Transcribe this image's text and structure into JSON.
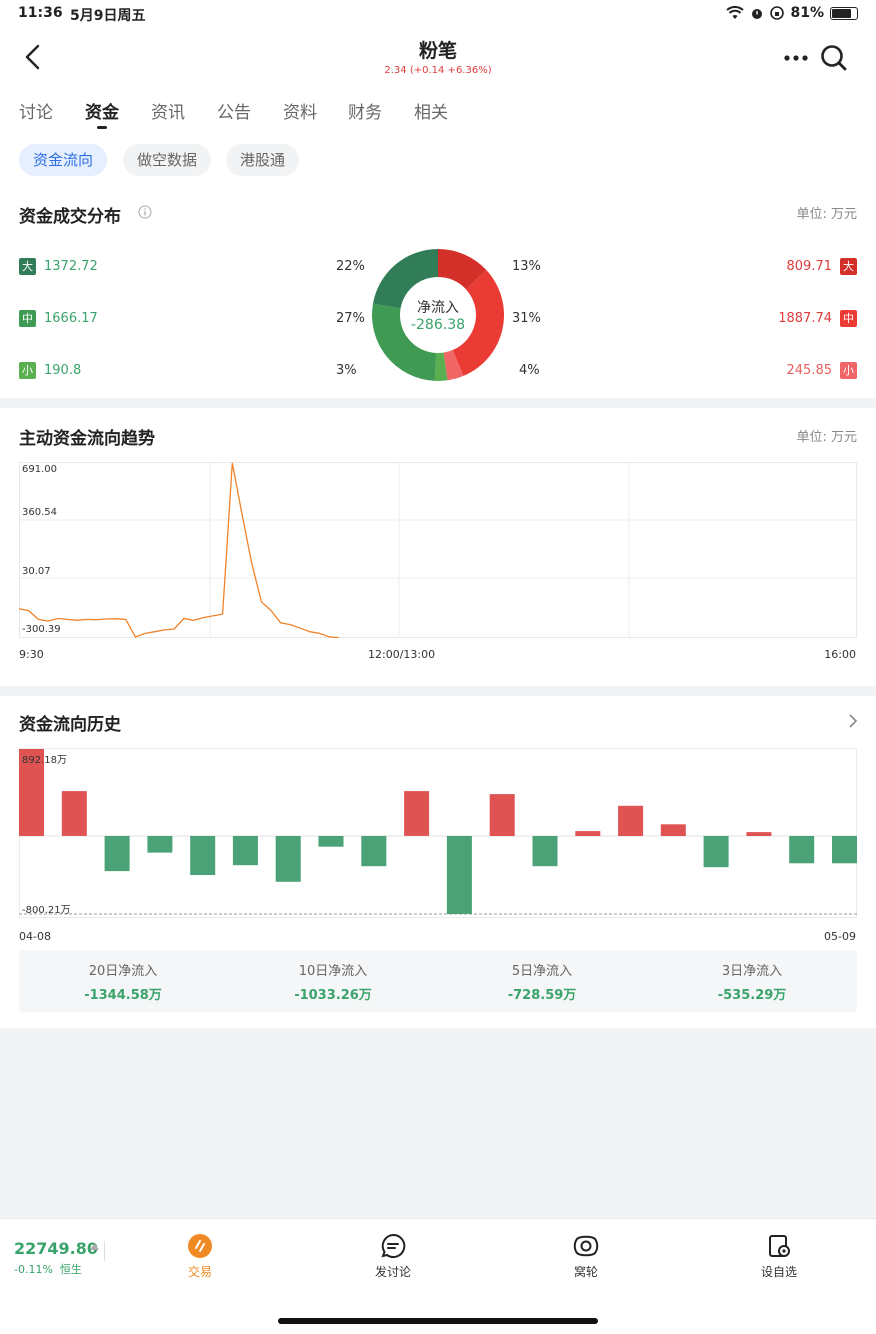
{
  "status": {
    "time": "11:36",
    "date": "5月9日周五",
    "battery": "81%"
  },
  "header": {
    "title": "粉笔",
    "subtitle": "2.34 (+0.14 +6.36%)"
  },
  "tabs": [
    "讨论",
    "资金",
    "资讯",
    "公告",
    "资料",
    "财务",
    "相关"
  ],
  "subtabs": [
    "资金流向",
    "做空数据",
    "港股通"
  ],
  "distribution": {
    "title": "资金成交分布",
    "unit": "单位: 万元",
    "center_label": "净流入",
    "center_value": "-286.38",
    "outflow": [
      {
        "tag": "大",
        "value": "1372.72",
        "pct": "22%"
      },
      {
        "tag": "中",
        "value": "1666.17",
        "pct": "27%"
      },
      {
        "tag": "小",
        "value": "190.8",
        "pct": "3%"
      }
    ],
    "inflow": [
      {
        "tag": "大",
        "value": "809.71",
        "pct": "13%"
      },
      {
        "tag": "中",
        "value": "1887.74",
        "pct": "31%"
      },
      {
        "tag": "小",
        "value": "245.85",
        "pct": "4%"
      }
    ],
    "colors": {
      "out_big": "#317d57",
      "out_mid": "#3f9a54",
      "out_small": "#5ab050",
      "in_big": "#d4302a",
      "in_mid": "#ea3b35",
      "in_small": "#f06565"
    }
  },
  "trend": {
    "title": "主动资金流向趋势",
    "unit": "单位: 万元",
    "y_labels": [
      "691.00",
      "360.54",
      "30.07",
      "-300.39"
    ],
    "x_labels": [
      "9:30",
      "12:00/13:00",
      "16:00"
    ]
  },
  "history": {
    "title": "资金流向历史",
    "max_label": "892.18万",
    "min_label": "-800.21万",
    "x_start": "04-08",
    "x_end": "05-09",
    "summary": [
      {
        "label": "20日净流入",
        "value": "-1344.58万"
      },
      {
        "label": "10日净流入",
        "value": "-1033.26万"
      },
      {
        "label": "5日净流入",
        "value": "-728.59万"
      },
      {
        "label": "3日净流入",
        "value": "-535.29万"
      }
    ]
  },
  "chart_data": [
    {
      "type": "pie",
      "title": "资金成交分布",
      "categories": [
        "大 流出",
        "中 流出",
        "小 流出",
        "大 流入",
        "中 流入",
        "小 流入"
      ],
      "values": [
        1372.72,
        1666.17,
        190.8,
        809.71,
        1887.74,
        245.85
      ],
      "percents": [
        22,
        27,
        3,
        13,
        31,
        4
      ]
    },
    {
      "type": "line",
      "title": "主动资金流向趋势",
      "ylim": [
        -300.39,
        691.0
      ],
      "x_ticks": [
        "9:30",
        "12:00/13:00",
        "16:00"
      ],
      "series": [
        {
          "values": [
            -140,
            -150,
            -200,
            -210,
            -195,
            -200,
            -205,
            -200,
            -202,
            -198,
            -196,
            -200,
            -300,
            -280,
            -270,
            -260,
            -255,
            -195,
            -205,
            -190,
            -180,
            -170,
            691,
            400,
            120,
            -100,
            -150,
            -220,
            -230,
            -250,
            -270,
            -280,
            -300,
            -305
          ]
        }
      ]
    },
    {
      "type": "bar",
      "title": "资金流向历史",
      "ylim": [
        -800.21,
        892.18
      ],
      "values": [
        892.18,
        460,
        -360,
        -170,
        -400,
        -300,
        -470,
        -110,
        -310,
        460,
        -800.21,
        430,
        -310,
        50,
        310,
        120,
        -320,
        40,
        -280,
        -280
      ]
    }
  ],
  "bottom": {
    "index_value": "22749.80",
    "index_change": "-0.11%",
    "index_name": "恒生",
    "nav": [
      "交易",
      "发讨论",
      "窝轮",
      "设自选"
    ]
  }
}
